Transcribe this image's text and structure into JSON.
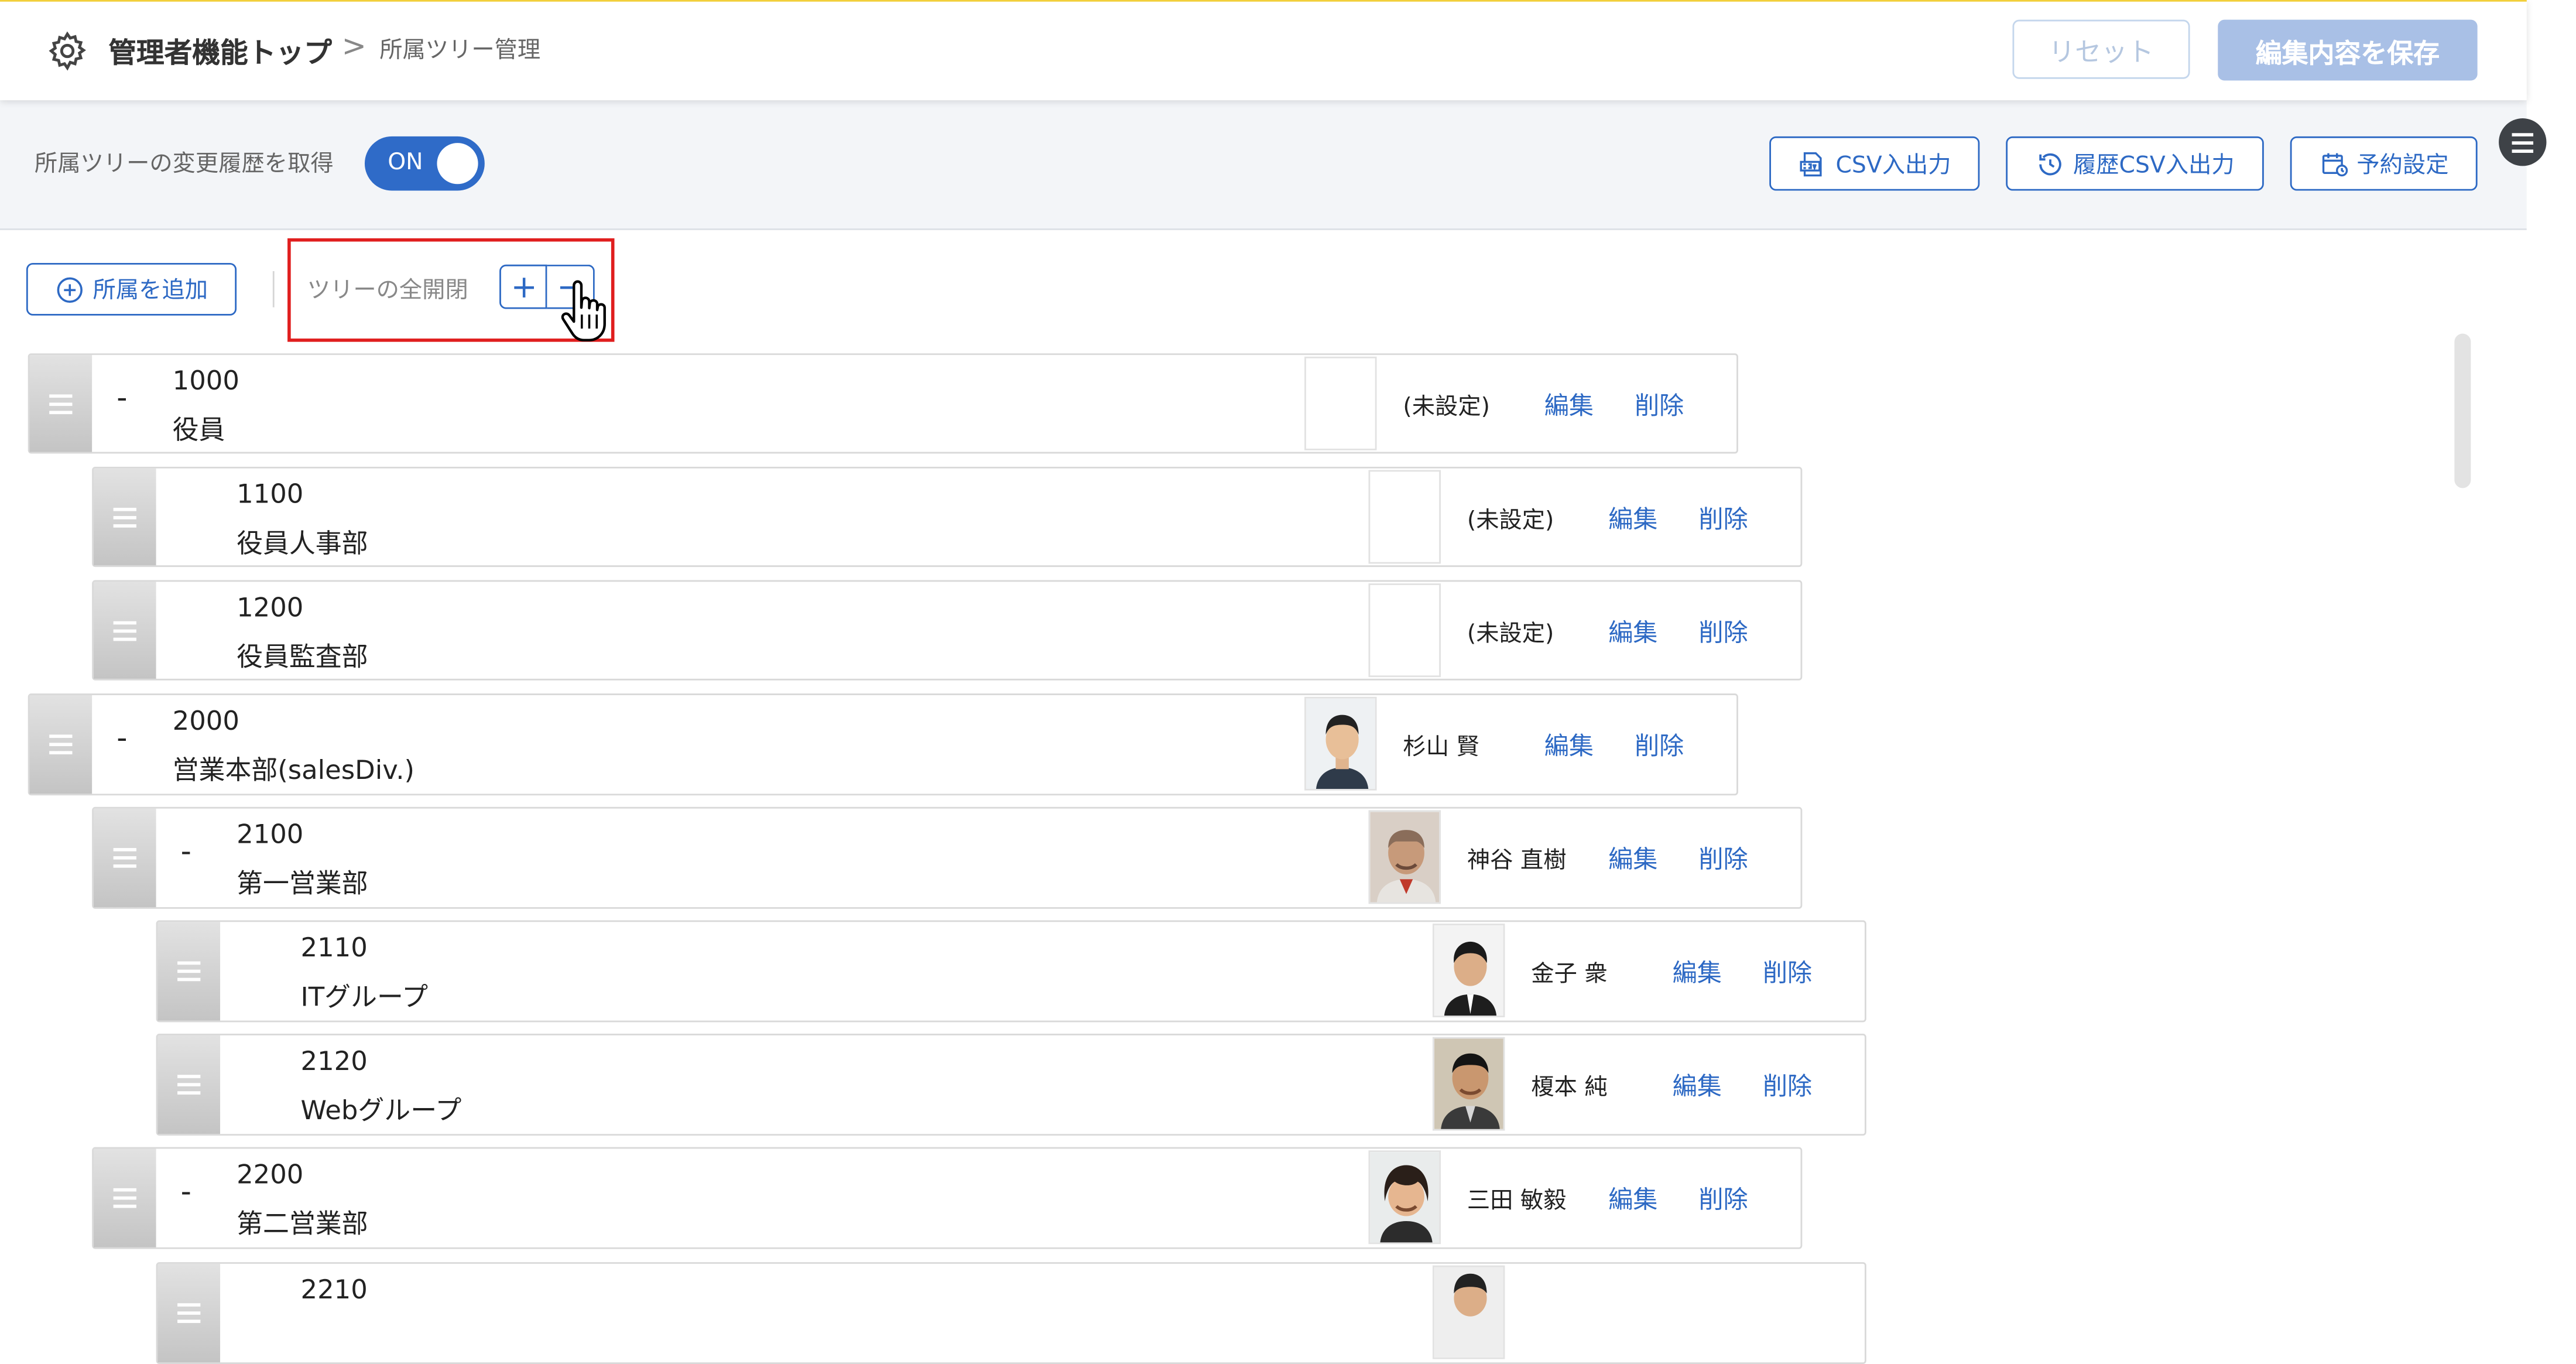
{
  "header": {
    "breadcrumb_top": "管理者機能トップ",
    "breadcrumb_sep": ">",
    "breadcrumb_current": "所属ツリー管理",
    "reset_label": "リセット",
    "save_label": "編集内容を保存"
  },
  "toolbar": {
    "history_label": "所属ツリーの変更履歴を取得",
    "toggle_label": "ON",
    "csv_label": "CSV入出力",
    "history_csv_label": "履歴CSV入出力",
    "schedule_label": "予約設定"
  },
  "tree_controls": {
    "add_label": "所属を追加",
    "expand_all_label": "ツリーの全開閉"
  },
  "rows": [
    {
      "code": "1000",
      "name": "役員",
      "dash": "-",
      "manager": "(未設定)",
      "edit": "編集",
      "delete": "削除"
    },
    {
      "code": "1100",
      "name": "役員人事部",
      "dash": "",
      "manager": "(未設定)",
      "edit": "編集",
      "delete": "削除"
    },
    {
      "code": "1200",
      "name": "役員監査部",
      "dash": "",
      "manager": "(未設定)",
      "edit": "編集",
      "delete": "削除"
    },
    {
      "code": "2000",
      "name": "営業本部(salesDiv.)",
      "dash": "-",
      "manager": "杉山 賢",
      "edit": "編集",
      "delete": "削除"
    },
    {
      "code": "2100",
      "name": "第一営業部",
      "dash": "-",
      "manager": "神谷 直樹",
      "edit": "編集",
      "delete": "削除"
    },
    {
      "code": "2110",
      "name": "ITグループ",
      "dash": "",
      "manager": "金子 衆",
      "edit": "編集",
      "delete": "削除"
    },
    {
      "code": "2120",
      "name": "Webグループ",
      "dash": "",
      "manager": "榎本 純",
      "edit": "編集",
      "delete": "削除"
    },
    {
      "code": "2200",
      "name": "第二営業部",
      "dash": "-",
      "manager": "三田 敏毅",
      "edit": "編集",
      "delete": "削除"
    },
    {
      "code": "2210",
      "name": "",
      "dash": "",
      "manager": "",
      "edit": "",
      "delete": ""
    }
  ],
  "colors": {
    "accent": "#2d69c4",
    "highlight": "#e01e1e",
    "header_line": "#f2cf3a"
  }
}
